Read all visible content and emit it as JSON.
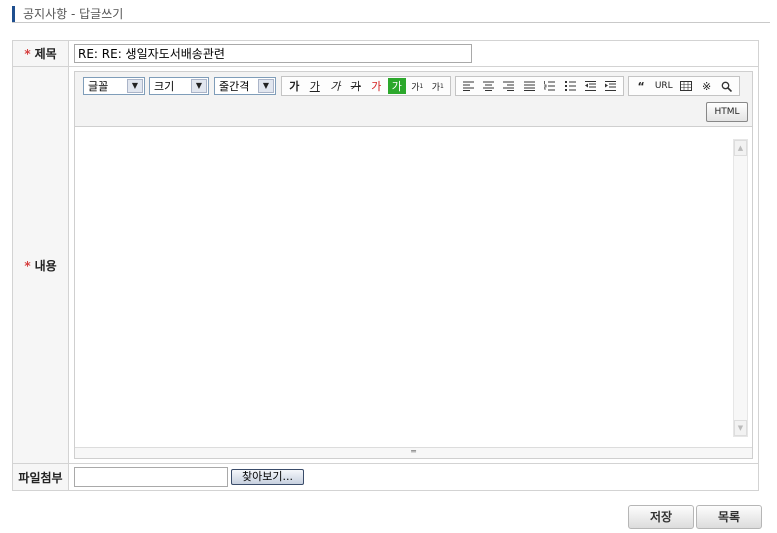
{
  "page": {
    "title": "공지사항 - 답글쓰기"
  },
  "form": {
    "subject_label": "제목",
    "subject_value": "RE: RE: 생일자도서배송관련",
    "content_label": "내용",
    "attachment_label": "파일첨부",
    "browse_label": "찾아보기...",
    "required_mark": "*"
  },
  "editor": {
    "font_select": "글꼴",
    "size_select": "크기",
    "line_height_select": "줄간격",
    "format_buttons": [
      "가",
      "가",
      "가",
      "가",
      "가",
      "가",
      "가",
      "가"
    ],
    "url_label": "URL",
    "html_label": "HTML"
  },
  "actions": {
    "save_label": "저장",
    "list_label": "목록"
  },
  "colors": {
    "accent": "#1f4f8f",
    "required": "#d63e3e",
    "green_bg": "#2ca82c",
    "red_text": "#d31d1d"
  }
}
